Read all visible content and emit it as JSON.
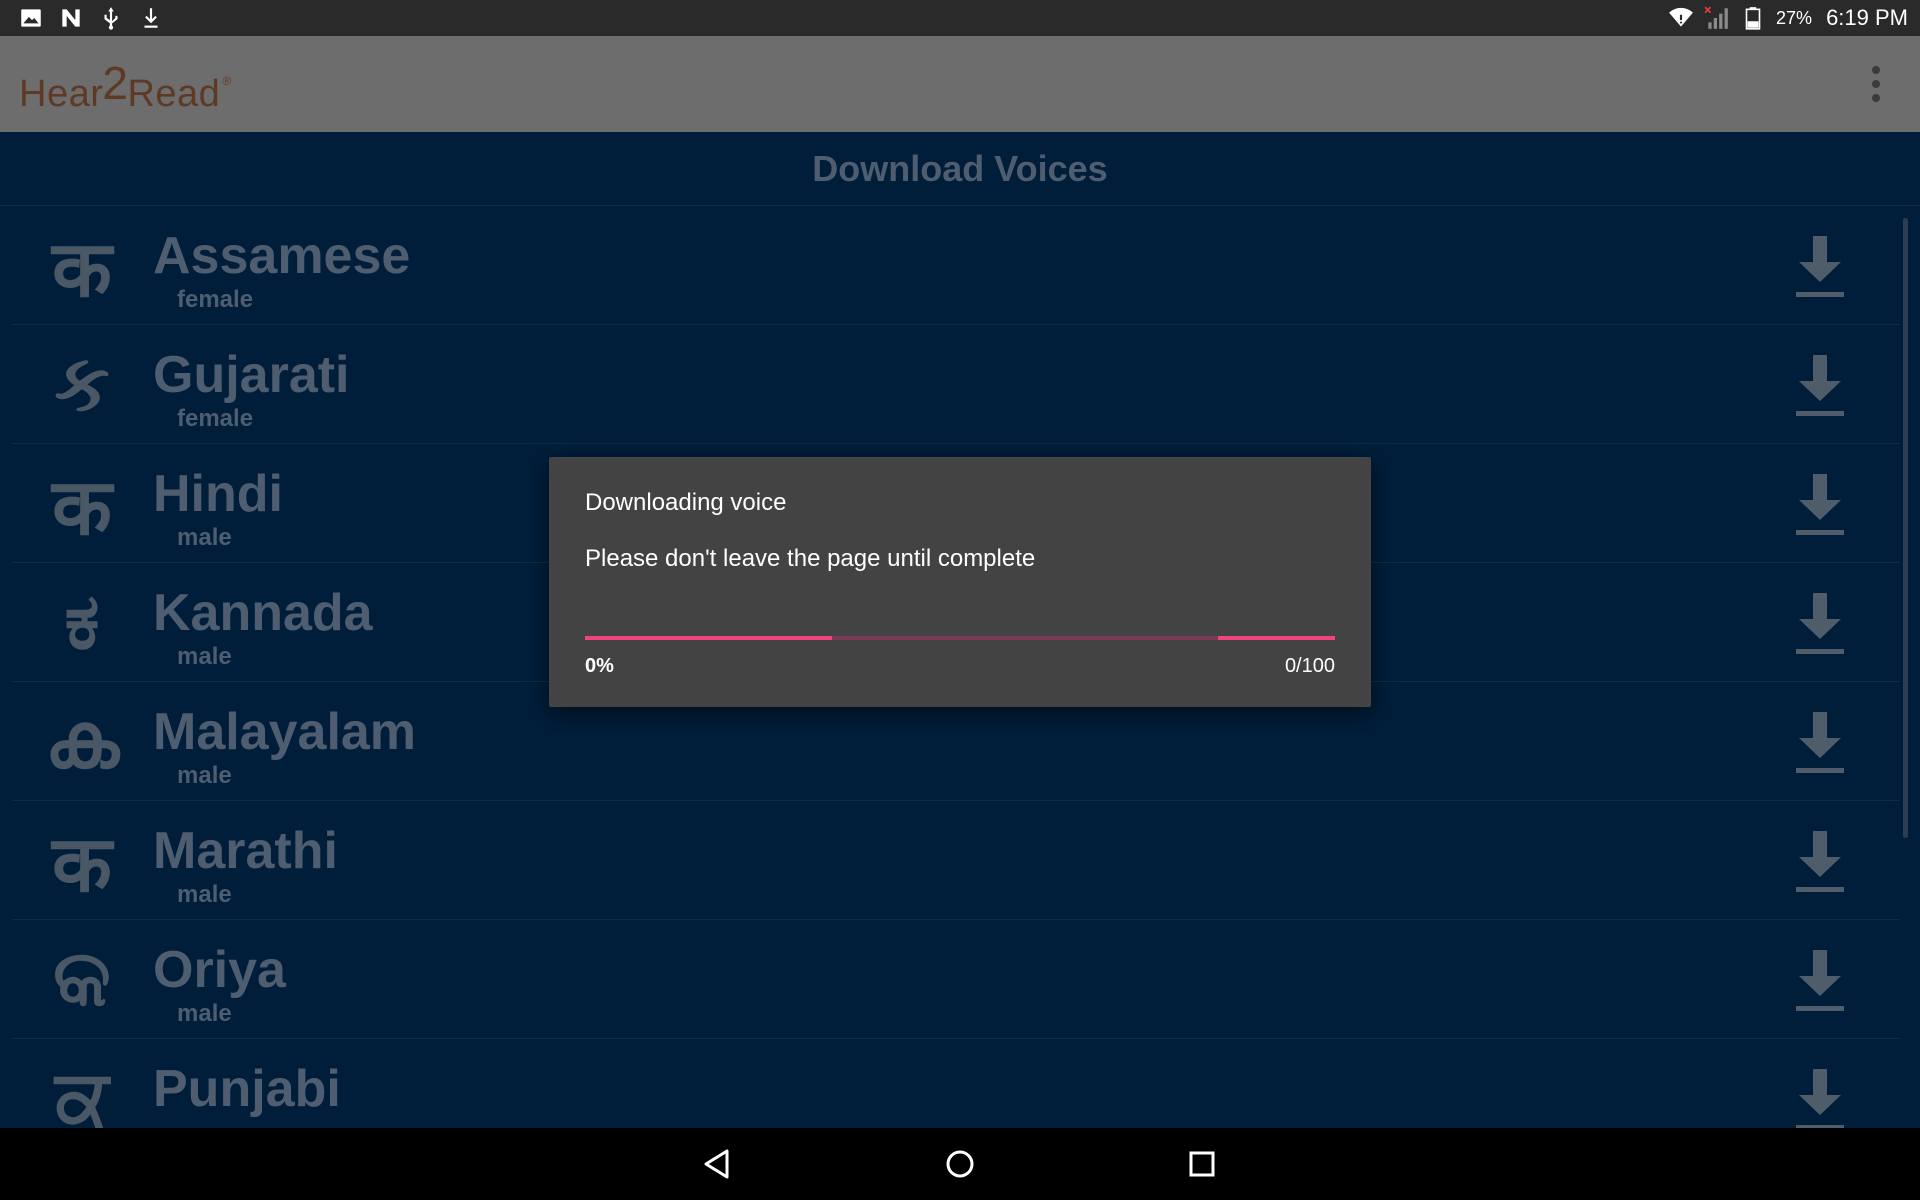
{
  "status_bar": {
    "left_icons": [
      "gallery-icon",
      "n-notification-icon",
      "usb-icon",
      "download-notification-icon"
    ],
    "battery_percent": "27%",
    "time": "6:19 PM"
  },
  "app_bar": {
    "logo": {
      "part1": "Hear",
      "part2": "2",
      "part3": "Read",
      "mark": "®"
    }
  },
  "page": {
    "title": "Download Voices"
  },
  "voices": [
    {
      "glyph": "क",
      "name": "Assamese",
      "gender": "female"
    },
    {
      "glyph": "ક",
      "name": "Gujarati",
      "gender": "female"
    },
    {
      "glyph": "क",
      "name": "Hindi",
      "gender": "male"
    },
    {
      "glyph": "ಕ",
      "name": "Kannada",
      "gender": "male"
    },
    {
      "glyph": "ക",
      "name": "Malayalam",
      "gender": "male"
    },
    {
      "glyph": "क",
      "name": "Marathi",
      "gender": "male"
    },
    {
      "glyph": "କ",
      "name": "Oriya",
      "gender": "male"
    },
    {
      "glyph": "ਕ",
      "name": "Punjabi",
      "gender": ""
    }
  ],
  "dialog": {
    "title": "Downloading voice",
    "message": "Please don't leave the page until complete",
    "progress_percent": "0%",
    "progress_count": "0/100",
    "progress_value": 0
  },
  "colors": {
    "accent": "#f2457f",
    "app_bar": "#6d6d6d",
    "background": "#001e3a",
    "dialog": "#434343"
  }
}
